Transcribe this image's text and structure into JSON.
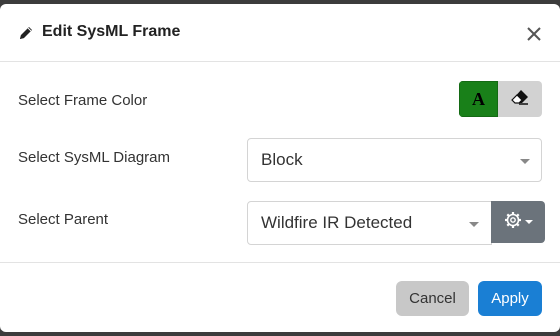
{
  "dialog": {
    "title": "Edit SysML Frame",
    "title_icon": "pencil-icon",
    "close_icon": "close-icon"
  },
  "fields": {
    "frame_color": {
      "label": "Select Frame Color",
      "text_color_button": "A",
      "text_color_active": "#198019",
      "eraser_icon": "eraser-icon"
    },
    "diagram": {
      "label": "Select SysML Diagram",
      "value": "Block"
    },
    "parent": {
      "label": "Select Parent",
      "value": "Wildfire IR Detected",
      "settings_icon": "gear-icon"
    }
  },
  "footer": {
    "cancel_label": "Cancel",
    "apply_label": "Apply",
    "apply_color": "#1a7fd4"
  }
}
